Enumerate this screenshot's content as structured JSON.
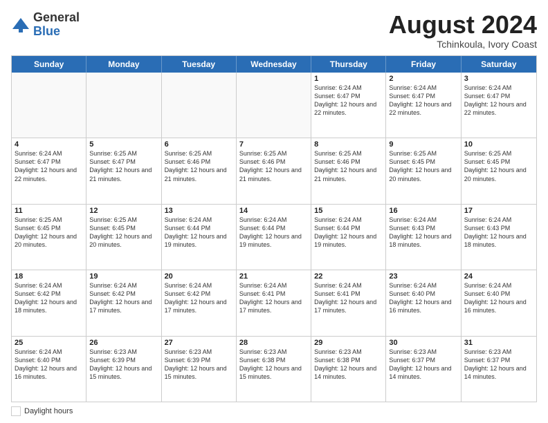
{
  "logo": {
    "general": "General",
    "blue": "Blue"
  },
  "header": {
    "title": "August 2024",
    "subtitle": "Tchinkoula, Ivory Coast"
  },
  "days_of_week": [
    "Sunday",
    "Monday",
    "Tuesday",
    "Wednesday",
    "Thursday",
    "Friday",
    "Saturday"
  ],
  "weeks": [
    [
      {
        "day": "",
        "info": "",
        "empty": true
      },
      {
        "day": "",
        "info": "",
        "empty": true
      },
      {
        "day": "",
        "info": "",
        "empty": true
      },
      {
        "day": "",
        "info": "",
        "empty": true
      },
      {
        "day": "1",
        "info": "Sunrise: 6:24 AM\nSunset: 6:47 PM\nDaylight: 12 hours\nand 22 minutes.",
        "empty": false
      },
      {
        "day": "2",
        "info": "Sunrise: 6:24 AM\nSunset: 6:47 PM\nDaylight: 12 hours\nand 22 minutes.",
        "empty": false
      },
      {
        "day": "3",
        "info": "Sunrise: 6:24 AM\nSunset: 6:47 PM\nDaylight: 12 hours\nand 22 minutes.",
        "empty": false
      }
    ],
    [
      {
        "day": "4",
        "info": "Sunrise: 6:24 AM\nSunset: 6:47 PM\nDaylight: 12 hours\nand 22 minutes.",
        "empty": false
      },
      {
        "day": "5",
        "info": "Sunrise: 6:25 AM\nSunset: 6:47 PM\nDaylight: 12 hours\nand 21 minutes.",
        "empty": false
      },
      {
        "day": "6",
        "info": "Sunrise: 6:25 AM\nSunset: 6:46 PM\nDaylight: 12 hours\nand 21 minutes.",
        "empty": false
      },
      {
        "day": "7",
        "info": "Sunrise: 6:25 AM\nSunset: 6:46 PM\nDaylight: 12 hours\nand 21 minutes.",
        "empty": false
      },
      {
        "day": "8",
        "info": "Sunrise: 6:25 AM\nSunset: 6:46 PM\nDaylight: 12 hours\nand 21 minutes.",
        "empty": false
      },
      {
        "day": "9",
        "info": "Sunrise: 6:25 AM\nSunset: 6:45 PM\nDaylight: 12 hours\nand 20 minutes.",
        "empty": false
      },
      {
        "day": "10",
        "info": "Sunrise: 6:25 AM\nSunset: 6:45 PM\nDaylight: 12 hours\nand 20 minutes.",
        "empty": false
      }
    ],
    [
      {
        "day": "11",
        "info": "Sunrise: 6:25 AM\nSunset: 6:45 PM\nDaylight: 12 hours\nand 20 minutes.",
        "empty": false
      },
      {
        "day": "12",
        "info": "Sunrise: 6:25 AM\nSunset: 6:45 PM\nDaylight: 12 hours\nand 20 minutes.",
        "empty": false
      },
      {
        "day": "13",
        "info": "Sunrise: 6:24 AM\nSunset: 6:44 PM\nDaylight: 12 hours\nand 19 minutes.",
        "empty": false
      },
      {
        "day": "14",
        "info": "Sunrise: 6:24 AM\nSunset: 6:44 PM\nDaylight: 12 hours\nand 19 minutes.",
        "empty": false
      },
      {
        "day": "15",
        "info": "Sunrise: 6:24 AM\nSunset: 6:44 PM\nDaylight: 12 hours\nand 19 minutes.",
        "empty": false
      },
      {
        "day": "16",
        "info": "Sunrise: 6:24 AM\nSunset: 6:43 PM\nDaylight: 12 hours\nand 18 minutes.",
        "empty": false
      },
      {
        "day": "17",
        "info": "Sunrise: 6:24 AM\nSunset: 6:43 PM\nDaylight: 12 hours\nand 18 minutes.",
        "empty": false
      }
    ],
    [
      {
        "day": "18",
        "info": "Sunrise: 6:24 AM\nSunset: 6:42 PM\nDaylight: 12 hours\nand 18 minutes.",
        "empty": false
      },
      {
        "day": "19",
        "info": "Sunrise: 6:24 AM\nSunset: 6:42 PM\nDaylight: 12 hours\nand 17 minutes.",
        "empty": false
      },
      {
        "day": "20",
        "info": "Sunrise: 6:24 AM\nSunset: 6:42 PM\nDaylight: 12 hours\nand 17 minutes.",
        "empty": false
      },
      {
        "day": "21",
        "info": "Sunrise: 6:24 AM\nSunset: 6:41 PM\nDaylight: 12 hours\nand 17 minutes.",
        "empty": false
      },
      {
        "day": "22",
        "info": "Sunrise: 6:24 AM\nSunset: 6:41 PM\nDaylight: 12 hours\nand 17 minutes.",
        "empty": false
      },
      {
        "day": "23",
        "info": "Sunrise: 6:24 AM\nSunset: 6:40 PM\nDaylight: 12 hours\nand 16 minutes.",
        "empty": false
      },
      {
        "day": "24",
        "info": "Sunrise: 6:24 AM\nSunset: 6:40 PM\nDaylight: 12 hours\nand 16 minutes.",
        "empty": false
      }
    ],
    [
      {
        "day": "25",
        "info": "Sunrise: 6:24 AM\nSunset: 6:40 PM\nDaylight: 12 hours\nand 16 minutes.",
        "empty": false
      },
      {
        "day": "26",
        "info": "Sunrise: 6:23 AM\nSunset: 6:39 PM\nDaylight: 12 hours\nand 15 minutes.",
        "empty": false
      },
      {
        "day": "27",
        "info": "Sunrise: 6:23 AM\nSunset: 6:39 PM\nDaylight: 12 hours\nand 15 minutes.",
        "empty": false
      },
      {
        "day": "28",
        "info": "Sunrise: 6:23 AM\nSunset: 6:38 PM\nDaylight: 12 hours\nand 15 minutes.",
        "empty": false
      },
      {
        "day": "29",
        "info": "Sunrise: 6:23 AM\nSunset: 6:38 PM\nDaylight: 12 hours\nand 14 minutes.",
        "empty": false
      },
      {
        "day": "30",
        "info": "Sunrise: 6:23 AM\nSunset: 6:37 PM\nDaylight: 12 hours\nand 14 minutes.",
        "empty": false
      },
      {
        "day": "31",
        "info": "Sunrise: 6:23 AM\nSunset: 6:37 PM\nDaylight: 12 hours\nand 14 minutes.",
        "empty": false
      }
    ]
  ],
  "footer": {
    "daylight_label": "Daylight hours"
  }
}
